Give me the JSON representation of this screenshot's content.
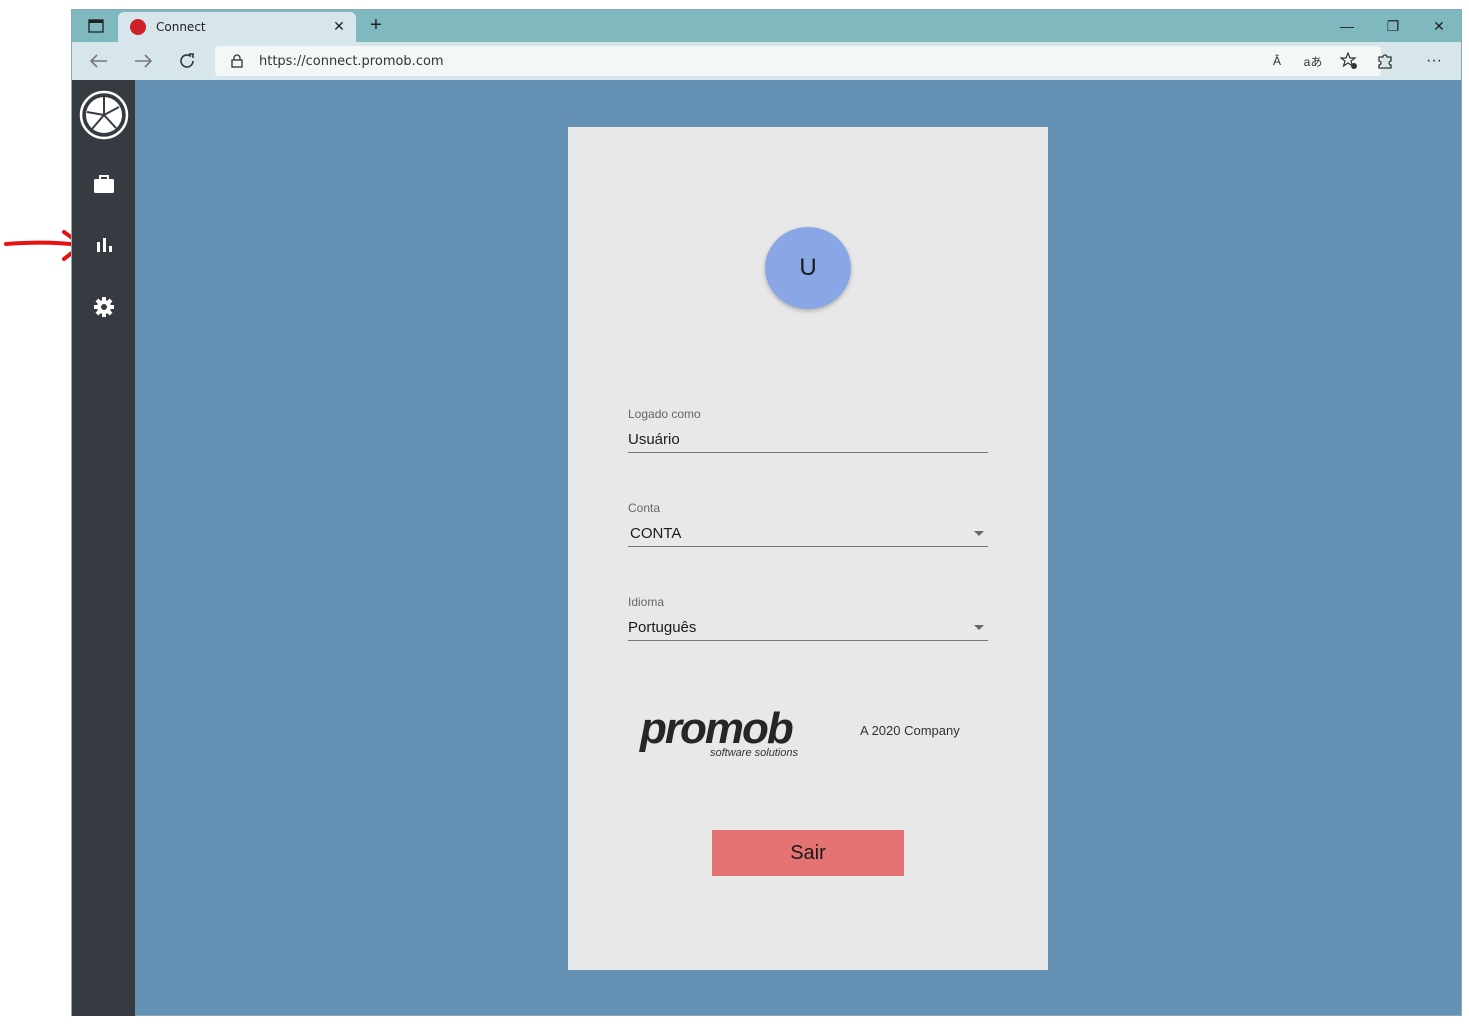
{
  "browser": {
    "tab_title": "Connect",
    "tab_close": "✕",
    "new_tab": "+",
    "url": "https://connect.promob.com",
    "window_controls": {
      "minimize": "—",
      "restore": "❐",
      "close": "✕"
    },
    "read_aloud_label": "Â",
    "translate_label": "aあ",
    "more_label": "···"
  },
  "sidebar": {
    "items": [
      {
        "icon": "promob-logo-icon"
      },
      {
        "icon": "briefcase-icon"
      },
      {
        "icon": "bar-chart-icon"
      },
      {
        "icon": "gear-icon"
      }
    ]
  },
  "profile": {
    "avatar_initial": "U",
    "logged_as": {
      "label": "Logado como",
      "value": "Usuário"
    },
    "account": {
      "label": "Conta",
      "value": "CONTA"
    },
    "language": {
      "label": "Idioma",
      "value": "Português"
    }
  },
  "brand": {
    "logo_word": "promob",
    "logo_tagline": "software solutions",
    "company": "A 2020 Company"
  },
  "actions": {
    "logout_label": "Sair"
  },
  "annotation": {
    "arrow_color": "#e81010"
  },
  "colors": {
    "titlebar": "#80b8c0",
    "content_bg": "#6490b4",
    "sidebar": "#363b42",
    "card": "#e8e8e8",
    "avatar": "#8aa6e4",
    "logout": "#e57373"
  }
}
